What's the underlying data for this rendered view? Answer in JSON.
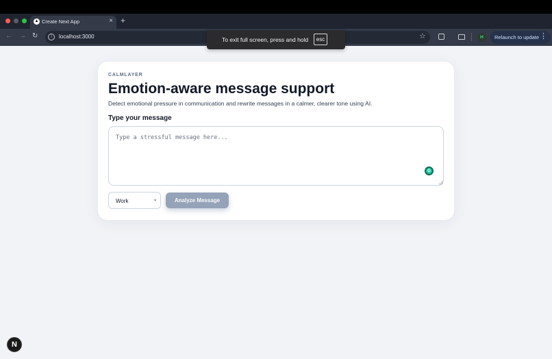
{
  "browser": {
    "tab_title": "Create Next App",
    "tab_close_icon": "×",
    "new_tab_icon": "+",
    "url": "localhost:3000",
    "profile_initial": "H",
    "relaunch_label": "Relaunch to update",
    "relaunch_menu_icon": "⋮",
    "back_icon": "←",
    "forward_icon": "→",
    "reload_icon": "↻",
    "site_info_icon": "i",
    "star_icon": "☆"
  },
  "fullscreen_toast": {
    "text": "To exit full screen, press and hold",
    "key": "esc"
  },
  "app": {
    "eyebrow": "CALMLAYER",
    "title": "Emotion-aware message support",
    "subtitle": "Detect emotional pressure in communication and rewrite messages in a calmer, clearer tone using AI.",
    "input_label": "Type your message",
    "input_placeholder": "Type a stressful message here...",
    "input_value": "",
    "tone_selected": "Work",
    "tone_chevron": "⌄",
    "analyze_label": "Analyze Message",
    "grammarly_glyph": "G"
  },
  "dev_indicator": "N",
  "colors": {
    "accent": "#95a3b8",
    "page_bg": "#f1f3f7",
    "card_bg": "#ffffff",
    "title": "#111827"
  }
}
